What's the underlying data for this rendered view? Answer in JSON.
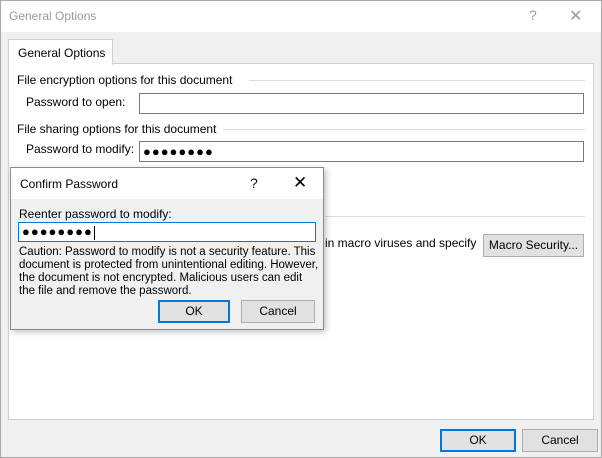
{
  "window": {
    "title": "General Options",
    "help_glyph": "?",
    "close_glyph": "✕"
  },
  "tab": {
    "label": "General Options"
  },
  "encryption": {
    "section_title": "File encryption options for this document",
    "password_open_label": "Password to open:",
    "password_open_value": ""
  },
  "sharing": {
    "section_title": "File sharing options for this document",
    "password_modify_label": "Password to modify:",
    "password_modify_value": "●●●●●●●●"
  },
  "macro": {
    "text_partial": "in macro viruses and specify",
    "button_label": "Macro Security..."
  },
  "footer": {
    "ok_label": "OK",
    "cancel_label": "Cancel"
  },
  "confirm": {
    "title": "Confirm Password",
    "help_glyph": "?",
    "close_glyph": "✕",
    "reenter_label": "Reenter password to modify:",
    "password_value": "●●●●●●●●",
    "caution": "Caution: Password to modify is not a security feature. This document is protected from unintentional editing. However, the document is not encrypted. Malicious users can edit the file and remove the password.",
    "ok_label": "OK",
    "cancel_label": "Cancel"
  }
}
